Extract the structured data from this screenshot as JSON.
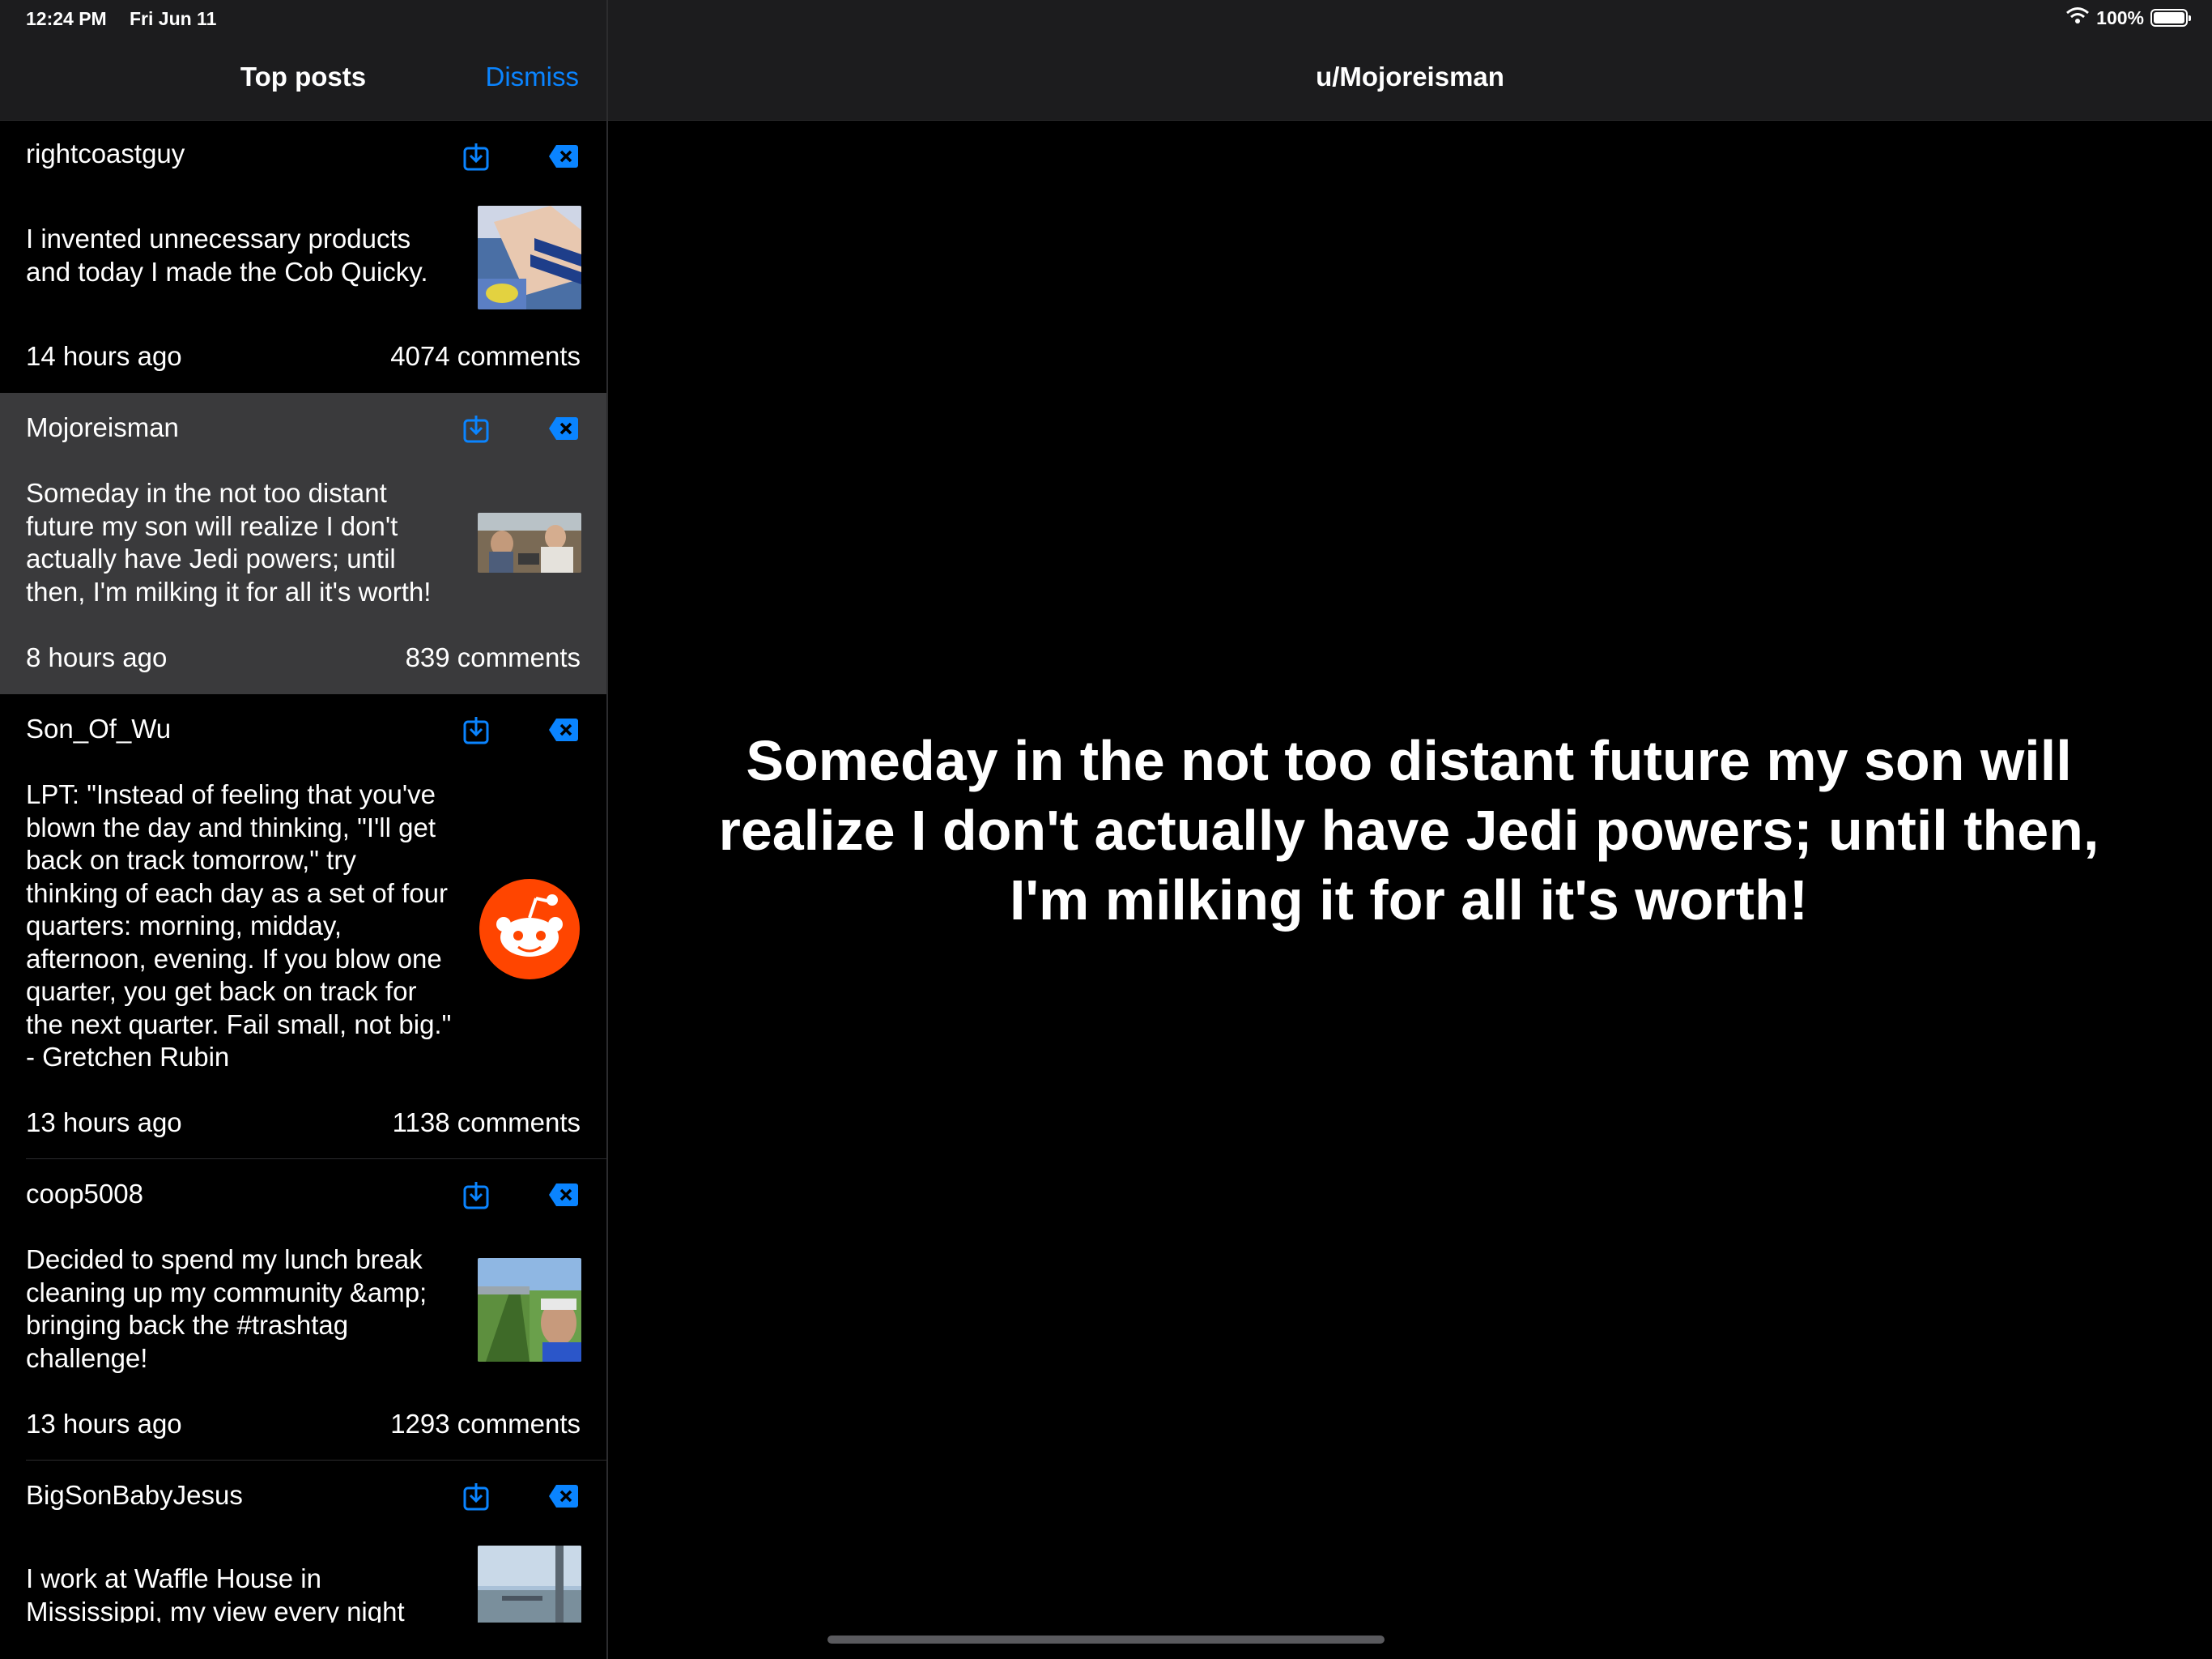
{
  "status": {
    "time": "12:24 PM",
    "date": "Fri Jun 11",
    "battery": "100%"
  },
  "sidebar": {
    "title": "Top posts",
    "dismiss_label": "Dismiss"
  },
  "posts": [
    {
      "author": "rightcoastguy",
      "title": "I invented unnecessary products and today I made the Cob Quicky.",
      "time": "14 hours ago",
      "comments": "4074 comments",
      "thumb": "photo"
    },
    {
      "author": "Mojoreisman",
      "title": "Someday in the not too distant future my son will realize I don't actually have Jedi powers; until then, I'm milking it for all it's worth!",
      "time": "8 hours ago",
      "comments": "839 comments",
      "thumb": "photo",
      "selected": true
    },
    {
      "author": "Son_Of_Wu",
      "title": "LPT: \"Instead of feeling that you've blown the day and thinking, \"I'll get back on track tomorrow,\" try thinking of each day as a set of four quarters: morning, midday, afternoon, evening. If you blow one quarter, you get back on track for the next quarter. Fail small, not big.\" - Gretchen Rubin",
      "time": "13 hours ago",
      "comments": "1138 comments",
      "thumb": "reddit-logo"
    },
    {
      "author": "coop5008",
      "title": "Decided to spend my lunch break cleaning up my community &amp; bringing back the #trashtag challenge!",
      "time": "13 hours ago",
      "comments": "1293 comments",
      "thumb": "photo"
    },
    {
      "author": "BigSonBabyJesus",
      "title": "I work at Waffle House in Mississippi, my view every night",
      "time": "",
      "comments": "",
      "thumb": "photo"
    }
  ],
  "main": {
    "title": "u/Mojoreisman",
    "text": "Someday in the not too distant future my son will realize I don't actually have Jedi powers; until then, I'm milking it for all it's worth!"
  },
  "colors": {
    "accent": "#0a84ff",
    "selected_row": "#3a3a3c",
    "reddit": "#ff4500"
  },
  "icons": {
    "download": "download-icon",
    "hide": "hide-post-icon",
    "wifi": "wifi-icon",
    "battery": "battery-icon"
  }
}
